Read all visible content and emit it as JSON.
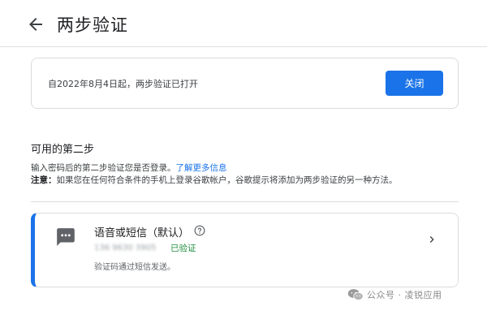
{
  "header": {
    "back_icon": "arrow-back-icon",
    "title": "两步验证"
  },
  "status": {
    "text": "自2022年8月4日起，两步验证已打开",
    "off_button_label": "关闭",
    "accent_color": "#1a73e8"
  },
  "available_steps": {
    "title": "可用的第二步",
    "description": "输入密码后的第二步验证您是否登录。",
    "learn_more_link": "了解更多信息",
    "note_label": "注意：",
    "note_text": "如果您在任何符合条件的手机上登录谷歌帐户，谷歌提示将添加为两步验证的另一种方法。"
  },
  "sms_option": {
    "icon": "message-icon",
    "title": "语音或短信（默认）",
    "help_icon": "help-circle-icon",
    "phone_number": "136 9630 3905",
    "verified_label": "已验证",
    "verified_color": "#1e8e3e",
    "description": "验证码通过短信发送。",
    "chevron_icon": "chevron-right-icon"
  },
  "watermark": {
    "text": "公众号 · 凌锐应用"
  }
}
